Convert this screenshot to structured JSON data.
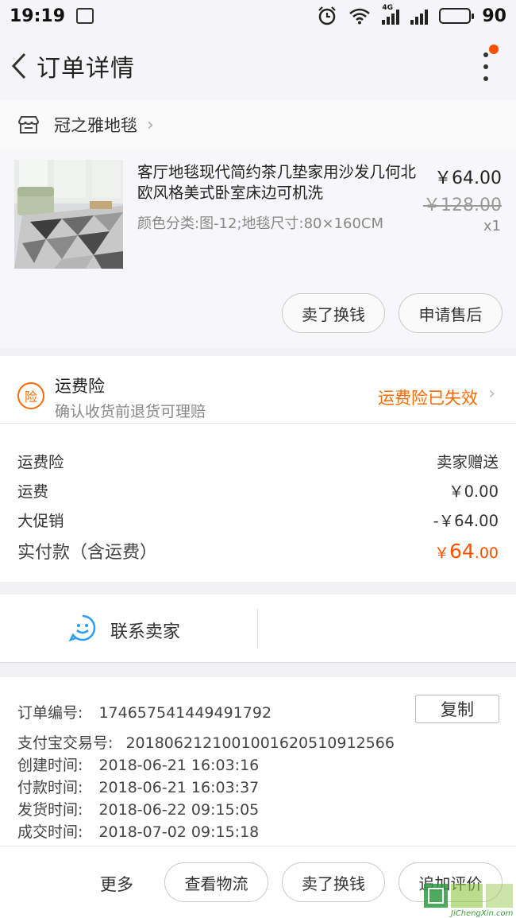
{
  "status_bar": {
    "time": "19:19",
    "network": "4G",
    "battery": "90"
  },
  "nav": {
    "title": "订单详情"
  },
  "shop": {
    "name": "冠之雅地毯"
  },
  "product": {
    "title": "客厅地毯现代简约茶几垫家用沙发几何北欧风格美式卧室床边可机洗",
    "spec": "颜色分类:图-12;地毯尺寸:80×160CM",
    "price": "￥64.00",
    "original_price": "￥128.00",
    "quantity": "x1",
    "actions": [
      "卖了换钱",
      "申请售后"
    ]
  },
  "insurance": {
    "badge": "险",
    "title": "运费险",
    "subtitle": "确认收货前退货可理赔",
    "status": "运费险已失效",
    "status_color": "#ff6a00"
  },
  "fees": [
    {
      "label": "运费险",
      "value": "卖家赠送"
    },
    {
      "label": "运费",
      "value": "￥0.00"
    },
    {
      "label": "大促销",
      "value": "-￥64.00"
    }
  ],
  "total": {
    "label": "实付款（含运费）",
    "currency": "￥",
    "integer": "64",
    "decimal": ".00",
    "color": "#ff5000"
  },
  "contact": {
    "label": "联系卖家"
  },
  "order_info": {
    "copy_label": "复制",
    "rows": [
      {
        "label": "订单编号:",
        "value": "174657541449491792"
      },
      {
        "label": "支付宝交易号:",
        "value": "2018062121001001620510912566"
      },
      {
        "label": "创建时间:",
        "value": "2018-06-21 16:03:16"
      },
      {
        "label": "付款时间:",
        "value": "2018-06-21 16:03:37"
      },
      {
        "label": "发货时间:",
        "value": "2018-06-22 09:15:05"
      },
      {
        "label": "成交时间:",
        "value": "2018-07-02 09:15:18"
      }
    ]
  },
  "bottom_bar": {
    "more_label": "更多",
    "buttons": [
      "查看物流",
      "卖了换钱",
      "追加评价"
    ]
  },
  "watermark": {
    "text": "JiChengXin.com"
  }
}
